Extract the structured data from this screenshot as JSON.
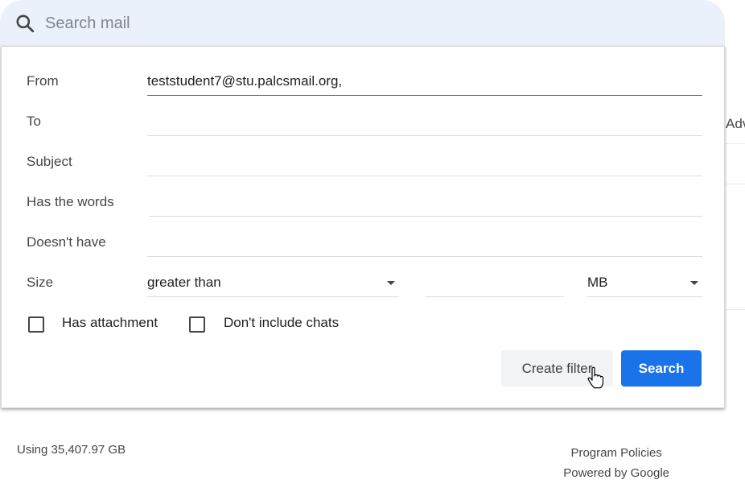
{
  "search": {
    "placeholder": "Search mail",
    "value": ""
  },
  "background": {
    "adv_label": "Adv"
  },
  "form": {
    "from_label": "From",
    "from_value": "teststudent7@stu.palcsmail.org,",
    "to_label": "To",
    "to_value": "",
    "subject_label": "Subject",
    "subject_value": "",
    "has_words_label": "Has the words",
    "has_words_value": "",
    "doesnt_have_label": "Doesn't have",
    "doesnt_have_value": "",
    "size_label": "Size",
    "size_comparator": "greater than",
    "size_value": "",
    "size_unit": "MB",
    "has_attachment_label": "Has attachment",
    "dont_include_chats_label": "Don't include chats",
    "create_filter_label": "Create filter",
    "search_button_label": "Search"
  },
  "footer": {
    "storage": "Using 35,407.97 GB",
    "program_policies": "Program Policies",
    "powered_by": "Powered by Google"
  },
  "colors": {
    "accent": "#1a73e8",
    "searchbar_bg": "#eaf1fb"
  },
  "icons": [
    "search-icon",
    "chevron-down-icon",
    "hand-cursor-icon"
  ]
}
